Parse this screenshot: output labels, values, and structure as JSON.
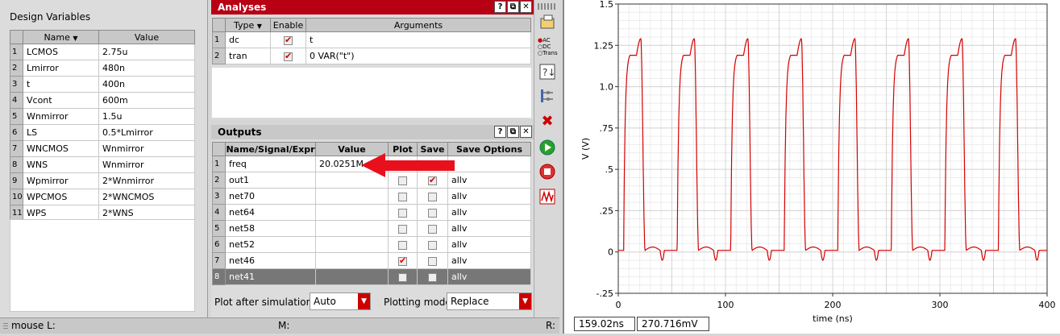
{
  "design_variables": {
    "title": "Design Variables",
    "col_name": "Name",
    "col_value": "Value",
    "rows": [
      {
        "idx": "1",
        "name": "LCMOS",
        "value": "2.75u"
      },
      {
        "idx": "2",
        "name": "Lmirror",
        "value": "480n"
      },
      {
        "idx": "3",
        "name": "t",
        "value": "400n"
      },
      {
        "idx": "4",
        "name": "Vcont",
        "value": "600m"
      },
      {
        "idx": "5",
        "name": "Wnmirror",
        "value": "1.5u"
      },
      {
        "idx": "6",
        "name": "LS",
        "value": "0.5*Lmirror"
      },
      {
        "idx": "7",
        "name": "WNCMOS",
        "value": "Wnmirror"
      },
      {
        "idx": "8",
        "name": "WNS",
        "value": "Wnmirror"
      },
      {
        "idx": "9",
        "name": "Wpmirror",
        "value": "2*Wnmirror"
      },
      {
        "idx": "10",
        "name": "WPCMOS",
        "value": "2*WNCMOS"
      },
      {
        "idx": "11",
        "name": "WPS",
        "value": "2*WNS"
      }
    ]
  },
  "analyses": {
    "title": "Analyses",
    "col_type": "Type",
    "col_enable": "Enable",
    "col_args": "Arguments",
    "rows": [
      {
        "idx": "1",
        "type": "dc",
        "enabled": true,
        "args": "t"
      },
      {
        "idx": "2",
        "type": "tran",
        "enabled": true,
        "args": "0 VAR(\"t\")"
      }
    ]
  },
  "outputs": {
    "title": "Outputs",
    "col_name": "Name/Signal/Expr",
    "col_value": "Value",
    "col_plot": "Plot",
    "col_save": "Save",
    "col_opts": "Save Options",
    "rows": [
      {
        "idx": "1",
        "name": "freq",
        "value": "20.0251M",
        "plot": null,
        "save": null,
        "opts": ""
      },
      {
        "idx": "2",
        "name": "out1",
        "value": "",
        "plot": false,
        "save": true,
        "opts": "allv"
      },
      {
        "idx": "3",
        "name": "net70",
        "value": "",
        "plot": false,
        "save": false,
        "opts": "allv"
      },
      {
        "idx": "4",
        "name": "net64",
        "value": "",
        "plot": false,
        "save": false,
        "opts": "allv"
      },
      {
        "idx": "5",
        "name": "net58",
        "value": "",
        "plot": false,
        "save": false,
        "opts": "allv"
      },
      {
        "idx": "6",
        "name": "net52",
        "value": "",
        "plot": false,
        "save": false,
        "opts": "allv"
      },
      {
        "idx": "7",
        "name": "net46",
        "value": "",
        "plot": true,
        "save": false,
        "opts": "allv"
      },
      {
        "idx": "8",
        "name": "net41",
        "value": "",
        "plot": false,
        "save": false,
        "opts": "allv"
      }
    ],
    "plot_after_label": "Plot after simulation:",
    "plot_after_value": "Auto",
    "plotting_mode_label": "Plotting mode:",
    "plotting_mode_value": "Replace"
  },
  "toolbar": {
    "radio_ac": "AC",
    "radio_dc": "DC",
    "radio_trans": "Trans"
  },
  "status": {
    "mouse_l": "mouse L:",
    "mouse_m": "M:",
    "mouse_r": "R:"
  },
  "readout": {
    "x": "159.02ns",
    "y": "270.716mV"
  },
  "colors": {
    "trace": "#d40000",
    "arrow": "#e8101c",
    "title_bar": "#b80014"
  },
  "chart_data": {
    "type": "line",
    "xlabel": "time (ns)",
    "ylabel": "V (V)",
    "xlim": [
      0,
      400
    ],
    "ylim": [
      -0.25,
      1.5
    ],
    "x_ticks": [
      "0",
      "100",
      "200",
      "300",
      "400"
    ],
    "y_ticks": [
      "-.25",
      "0",
      ".25",
      ".5",
      ".75",
      "1.0",
      "1.25",
      "1.5"
    ],
    "grid": true,
    "period_ns": 49.94,
    "v_high": 1.19,
    "v_low": 0.01,
    "v_peak": 1.29,
    "v_dip": -0.05,
    "rise_edges_ns": [
      5,
      55,
      105,
      155,
      205,
      255,
      305,
      355
    ],
    "fall_edges_ns": [
      25,
      75,
      125,
      175,
      225,
      275,
      325,
      375
    ]
  }
}
